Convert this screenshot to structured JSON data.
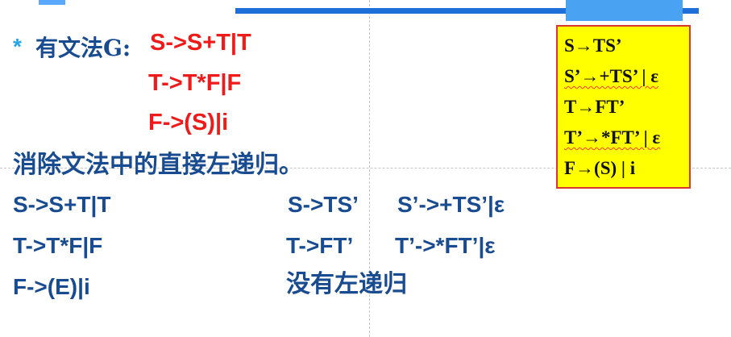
{
  "slide": {
    "bullet": "*",
    "intro_label": "有文法G:",
    "rules_red": [
      "S->S+T|T",
      "T->T*F|F",
      "F->(S)|i"
    ],
    "eliminate_text": "消除文法中的直接左递归。",
    "left_rules": [
      "S->S+T|T",
      "T->T*F|F",
      "F->(E)|i"
    ],
    "middle_rules": [
      "S->TS’",
      "T->FT’",
      "没有左递归"
    ],
    "right_rules": [
      "S’->+TS’|ε",
      "T’->*FT’|ε"
    ],
    "boxed_rules": [
      "S→TS’",
      "S’→+TS’ | ε",
      "T→FT’",
      "T’→*FT’ | ε",
      "F→(S) | i"
    ]
  }
}
